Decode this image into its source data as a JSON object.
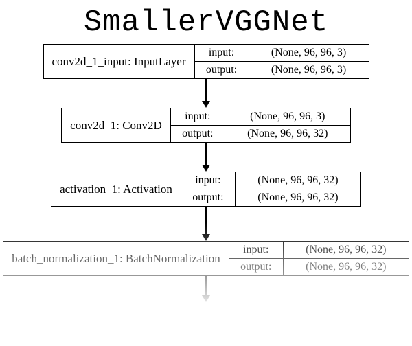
{
  "title": "SmallerVGGNet",
  "io_labels": {
    "input": "input:",
    "output": "output:"
  },
  "nodes": [
    {
      "name": "conv2d_1_input: InputLayer",
      "input": "(None, 96, 96, 3)",
      "output": "(None, 96, 96, 3)",
      "lab_w": 58,
      "val_w": 150,
      "arrow_after": 32
    },
    {
      "name": "conv2d_1: Conv2D",
      "input": "(None, 96, 96, 3)",
      "output": "(None, 96, 96, 32)",
      "lab_w": 58,
      "val_w": 158,
      "arrow_after": 32
    },
    {
      "name": "activation_1: Activation",
      "input": "(None, 96, 96, 32)",
      "output": "(None, 96, 96, 32)",
      "lab_w": 58,
      "val_w": 158,
      "arrow_after": 40
    },
    {
      "name": "batch_normalization_1: BatchNormalization",
      "input": "(None, 96, 96, 32)",
      "output": "(None, 96, 96, 32)",
      "lab_w": 58,
      "val_w": 158,
      "arrow_after": 28
    }
  ]
}
